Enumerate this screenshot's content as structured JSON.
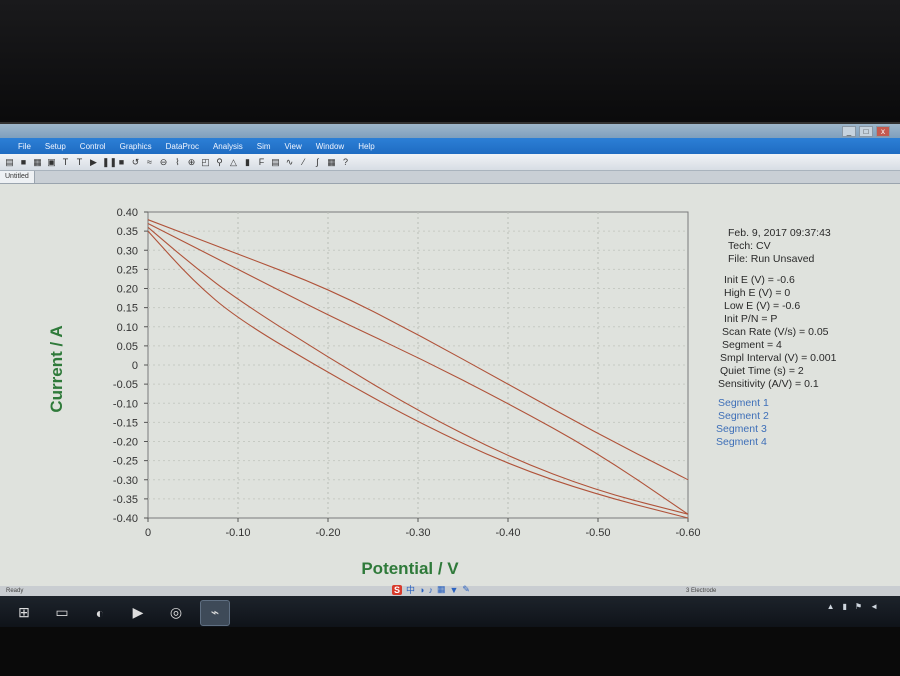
{
  "app": {
    "menu": [
      "File",
      "Setup",
      "Control",
      "Graphics",
      "DataProc",
      "Analysis",
      "Sim",
      "View",
      "Window",
      "Help"
    ],
    "tab_label": "Untitled",
    "window_buttons": [
      "_",
      "□",
      "x"
    ]
  },
  "chart_data": {
    "type": "line",
    "xlabel": "Potential / V",
    "ylabel": "Current / A",
    "xlim": [
      0,
      -0.6
    ],
    "ylim": [
      -0.4,
      0.4
    ],
    "x_ticks": [
      "0",
      "-0.10",
      "-0.20",
      "-0.30",
      "-0.40",
      "-0.50",
      "-0.60"
    ],
    "x_tick_values": [
      0,
      -0.1,
      -0.2,
      -0.3,
      -0.4,
      -0.5,
      -0.6
    ],
    "y_ticks": [
      "0.40",
      "0.35",
      "0.30",
      "0.25",
      "0.20",
      "0.15",
      "0.10",
      "0.05",
      "0",
      "-0.05",
      "-0.10",
      "-0.15",
      "-0.20",
      "-0.25",
      "-0.30",
      "-0.35",
      "-0.40"
    ],
    "y_tick_values": [
      0.4,
      0.35,
      0.3,
      0.25,
      0.2,
      0.15,
      0.1,
      0.05,
      0,
      -0.05,
      -0.1,
      -0.15,
      -0.2,
      -0.25,
      -0.3,
      -0.35,
      -0.4
    ],
    "grid": true,
    "line_color": "#b0533a",
    "series": [
      {
        "x": [
          0,
          -0.1,
          -0.2,
          -0.3,
          -0.4,
          -0.5,
          -0.6
        ],
        "y": [
          0.38,
          0.29,
          0.2,
          0.08,
          -0.05,
          -0.18,
          -0.3
        ]
      },
      {
        "x": [
          -0.6,
          -0.5,
          -0.4,
          -0.3,
          -0.2,
          -0.1,
          0
        ],
        "y": [
          -0.39,
          -0.23,
          -0.1,
          0.02,
          0.13,
          0.25,
          0.37
        ]
      },
      {
        "x": [
          0,
          -0.05,
          -0.1,
          -0.2,
          -0.3,
          -0.4,
          -0.5,
          -0.6
        ],
        "y": [
          0.36,
          0.26,
          0.17,
          0.02,
          -0.12,
          -0.24,
          -0.33,
          -0.39
        ]
      },
      {
        "x": [
          -0.6,
          -0.5,
          -0.4,
          -0.3,
          -0.2,
          -0.1,
          -0.05,
          0
        ],
        "y": [
          -0.4,
          -0.34,
          -0.26,
          -0.15,
          -0.02,
          0.12,
          0.22,
          0.35
        ]
      }
    ]
  },
  "info": {
    "date": "Feb. 9, 2017   09:37:43",
    "tech": "Tech: CV",
    "file": "File: Run Unsaved",
    "params": [
      "Init E (V) = -0.6",
      "High E (V) = 0",
      "Low E (V) = -0.6",
      "Init P/N = P",
      "Scan Rate (V/s) = 0.05",
      "Segment = 4",
      "Smpl Interval (V) = 0.001",
      "Quiet Time (s) = 2",
      "Sensitivity (A/V) = 0.1"
    ],
    "segments": [
      "Segment 1",
      "Segment 2",
      "Segment 3",
      "Segment 4"
    ],
    "segment_color": "#3e6fb8"
  },
  "status": {
    "left": "Ready",
    "right": "3 Electrode"
  }
}
